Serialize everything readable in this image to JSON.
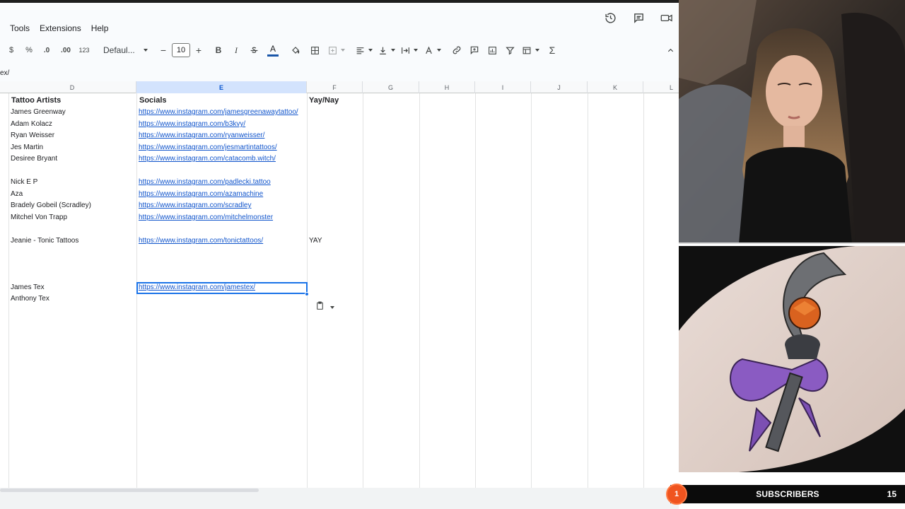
{
  "menu": {
    "items": [
      "Tools",
      "Extensions",
      "Help"
    ]
  },
  "toolbar": {
    "currency": "$",
    "percent": "%",
    "decrease_decimal": ".0",
    "increase_decimal": ".00",
    "number_format": "123",
    "font_name": "Defaul...",
    "font_size": "10",
    "minus": "−",
    "plus": "+",
    "bold": "B",
    "italic": "I",
    "text_color": "A",
    "functions": "Σ"
  },
  "formula_bar": {
    "text": "ex/"
  },
  "columns": [
    "D",
    "E",
    "F",
    "G",
    "H",
    "I",
    "J",
    "K",
    "L"
  ],
  "active_column": "E",
  "headers": {
    "artists": "Tattoo Artists",
    "socials": "Socials",
    "yaynay": "Yay/Nay"
  },
  "rows": [
    {
      "artist": "James Greenway",
      "social": "https://www.instagram.com/jamesgreenawaytattoo/",
      "yaynay": ""
    },
    {
      "artist": "Adam Kolacz",
      "social": "https://www.instagram.com/b3kvy/",
      "yaynay": ""
    },
    {
      "artist": "Ryan Weisser",
      "social": "https://www.instagram.com/ryanweisser/",
      "yaynay": ""
    },
    {
      "artist": "Jes Martin",
      "social": "https://www.instagram.com/jesmartintattoos/",
      "yaynay": ""
    },
    {
      "artist": "Desiree Bryant",
      "social": "https://www.instagram.com/catacomb.witch/",
      "yaynay": ""
    },
    {
      "artist": "",
      "social": "",
      "yaynay": ""
    },
    {
      "artist": "Nick E P",
      "social": "https://www.instagram.com/padlecki.tattoo",
      "yaynay": ""
    },
    {
      "artist": "Aza",
      "social": "https://www.instagram.com/azamachine",
      "yaynay": ""
    },
    {
      "artist": "Bradely Gobeil (Scradley)",
      "social": "https://www.instagram.com/scradley",
      "yaynay": ""
    },
    {
      "artist": "Mitchel Von Trapp",
      "social": "https://www.instagram.com/mitchelmonster",
      "yaynay": ""
    },
    {
      "artist": "",
      "social": "",
      "yaynay": ""
    },
    {
      "artist": "Jeanie - Tonic Tattoos",
      "social": "https://www.instagram.com/tonictattoos/",
      "yaynay": "YAY"
    },
    {
      "artist": "",
      "social": "",
      "yaynay": ""
    },
    {
      "artist": "",
      "social": "",
      "yaynay": ""
    },
    {
      "artist": "",
      "social": "",
      "yaynay": ""
    },
    {
      "artist": "James Tex",
      "social": "https://www.instagram.com/jamestex/",
      "yaynay": ""
    },
    {
      "artist": "Anthony Tex",
      "social": "",
      "yaynay": ""
    }
  ],
  "overlay": {
    "subscribers_badge": "1",
    "subscribers_label": "SUBSCRIBERS",
    "subscribers_count": "15"
  },
  "colors": {
    "link": "#1155cc",
    "selection": "#1a73e8",
    "active_header": "#d3e3fd",
    "badge": "#f0541f"
  }
}
